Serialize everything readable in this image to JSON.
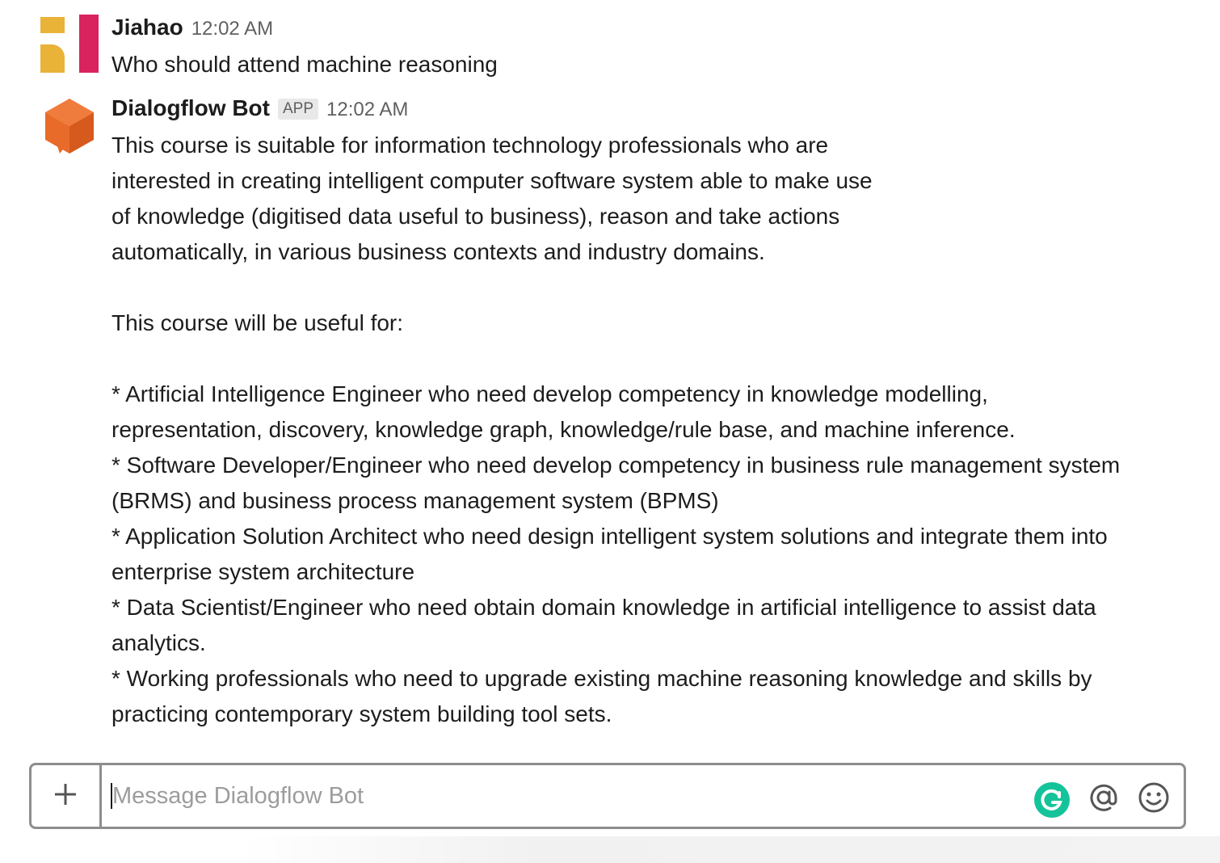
{
  "messages": [
    {
      "sender": "Jiahao",
      "time": "12:02 AM",
      "text": "Who should attend machine reasoning"
    },
    {
      "sender": "Dialogflow Bot",
      "badge": "APP",
      "time": "12:02 AM",
      "text": "This course is suitable for information technology professionals who are\ninterested in creating intelligent computer software system able to make use\nof knowledge (digitised data useful to business), reason and take actions\nautomatically, in various business contexts and industry domains.\n\nThis course will be useful for:\n\n* Artificial Intelligence Engineer who need develop competency in knowledge modelling,\nrepresentation, discovery, knowledge graph, knowledge/rule base, and machine inference.\n* Software Developer/Engineer who need develop competency in business rule management system\n(BRMS) and business process management system (BPMS)\n* Application Solution Architect who need design intelligent system solutions and integrate them into\nenterprise system architecture\n* Data Scientist/Engineer who need obtain domain knowledge in artificial intelligence to assist data\nanalytics.\n* Working professionals who need to upgrade existing machine reasoning knowledge and skills by\npracticing contemporary system building tool sets."
    }
  ],
  "composer": {
    "placeholder": "Message Dialogflow Bot",
    "icons": [
      "plus-icon",
      "grammarly-icon",
      "at-icon",
      "emoji-icon"
    ]
  },
  "colors": {
    "avatar_yellow": "#e9b338",
    "avatar_red": "#d9235f",
    "bot_orange": "#e86b2a",
    "grammarly_green": "#15c39a"
  }
}
